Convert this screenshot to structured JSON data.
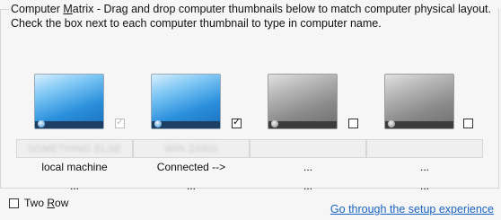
{
  "header": {
    "title_prefix": "Computer ",
    "title_underlined": "M",
    "title_rest": "atrix",
    "description": "  - Drag and drop computer thumbnails below to match computer physical layout. Check the box next to each computer thumbnail to type in computer name."
  },
  "slots": [
    {
      "name_value": "SOMETHING ELSE",
      "status": "local machine",
      "extra": "...",
      "checked_mark": "✓"
    },
    {
      "name_value": "WIN ZANG",
      "status": "Connected -->",
      "extra": "...",
      "checked_mark": "✓"
    },
    {
      "name_value": "",
      "status": "...",
      "extra": "...",
      "checked_mark": ""
    },
    {
      "name_value": "",
      "status": "...",
      "extra": "...",
      "checked_mark": ""
    }
  ],
  "options": {
    "two_row_label_prefix": "Two ",
    "two_row_label_underlined": "R",
    "two_row_label_rest": "ow"
  },
  "link": {
    "setup": "Go through the setup experience"
  }
}
